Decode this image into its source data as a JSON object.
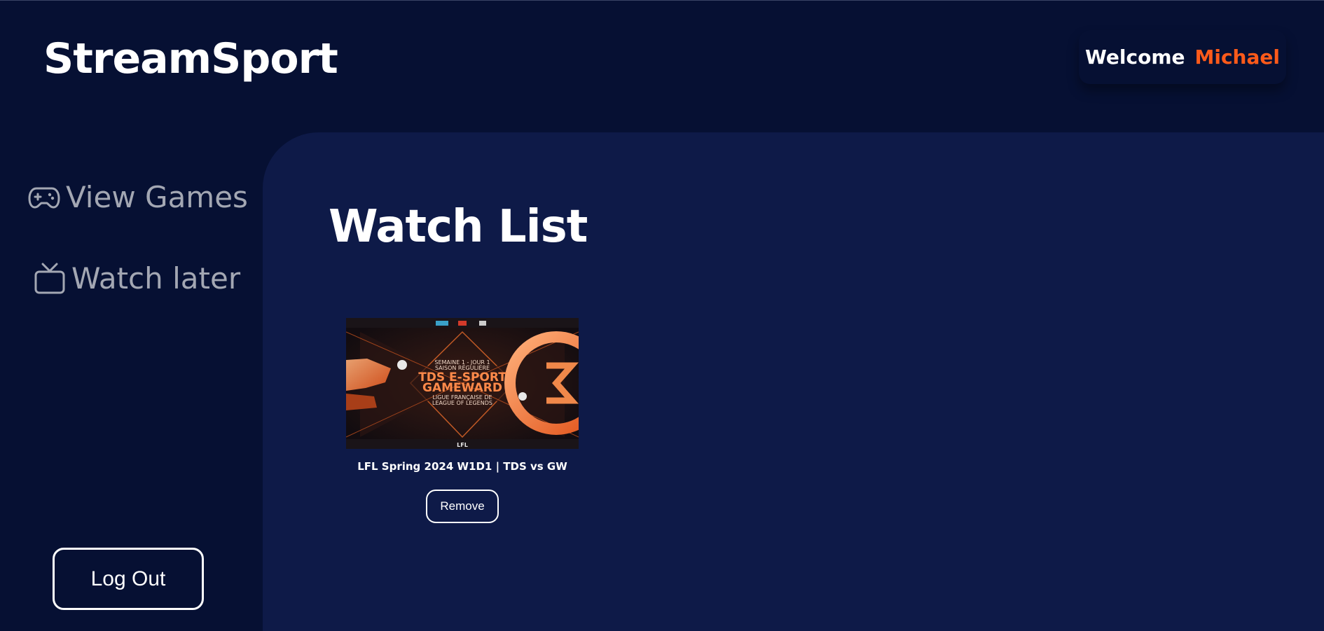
{
  "app": {
    "brand": "StreamSport"
  },
  "header": {
    "welcome_label": "Welcome",
    "user_name": "Michael"
  },
  "sidebar": {
    "items": [
      {
        "label": "View Games",
        "icon": "gamepad-icon"
      },
      {
        "label": "Watch later",
        "icon": "tv-icon"
      }
    ],
    "logout_label": "Log Out"
  },
  "main": {
    "title": "Watch List",
    "cards": [
      {
        "title": "LFL Spring 2024 W1D1 | TDS vs GW",
        "remove_label": "Remove",
        "thumbnail": {
          "line1": "SEMAINE 1 - JOUR 1",
          "line2": "SAISON RÉGULIÈRE",
          "line3": "TDS E-SPORT",
          "line4": "GAMEWARD",
          "line5": "LIGUE FRANÇAISE DE",
          "line6": "LEAGUE OF LEGENDS",
          "badge": "LFL"
        }
      }
    ]
  },
  "colors": {
    "accent": "#ff5a1a",
    "background": "#061033",
    "panel": "#0e1a48",
    "muted_text": "#a3a7b3"
  }
}
